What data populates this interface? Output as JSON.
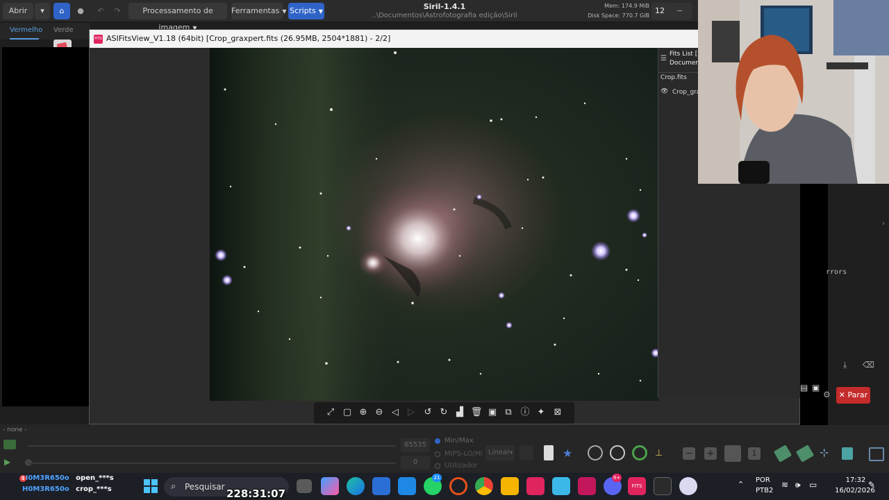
{
  "siril": {
    "title": "Siril-1.4.1",
    "path": "..\\Documentos\\Astrofotografia edição\\Siril",
    "open_label": "Abrir",
    "menu_image": "Processamento de imagem",
    "menu_tools": "Ferramentas",
    "menu_scripts": "Scripts",
    "mem": "Mem: 174.9 MiB",
    "disk": "Disk Space: 770.7 GiB",
    "threads": "12",
    "tab_red": "Vermelho",
    "tab_green": "Verde",
    "sequence_label": "- none -",
    "hi_value": "65535",
    "lo_value": "0",
    "radio_minmax": "Min/Max",
    "radio_mips": "MIPS-LO/HI",
    "radio_user": "Utilizador",
    "stretch_mode": "Linear",
    "stop_button": "Parar",
    "log_fragment": "rrors"
  },
  "fitsview": {
    "title": "ASIFitsView_V1.18 (64bit) [Crop_graxpert.fits (26.95MB, 2504*1881) - 2/2]",
    "app_icon": "FITS",
    "side_header1": "Fits List [",
    "side_header2": "Documen",
    "side_item1": "Crop.fits",
    "side_item2": "Crop_gra",
    "toolbar_icons": [
      "fit-screen-icon",
      "full-size-icon",
      "zoom-in-icon",
      "zoom-out-icon",
      "prev-icon",
      "next-icon",
      "rotate-left-icon",
      "rotate-right-icon",
      "histogram-icon",
      "delete-icon",
      "save-icon",
      "snapshot-icon",
      "info-icon",
      "star-icon",
      "crop-icon"
    ]
  },
  "taskbar": {
    "search_placeholder": "Pesquisar",
    "lang_line1": "POR",
    "lang_line2": "PTB2",
    "time": "17:32",
    "date": "16/02/2026",
    "whatsapp_badge": "21",
    "discord_badge": "9+",
    "fits_app_label": "FITS"
  },
  "stream_overlay": {
    "timer": "228:31:07",
    "chat": [
      {
        "user": "H0M3R650o",
        "message": "open_***s"
      },
      {
        "user": "H0M3R650o",
        "message": "crop_***s"
      }
    ],
    "chat_badge": "5"
  },
  "colors": {
    "accent_blue": "#2f63c7",
    "stop_red": "#c42b2b",
    "chat_user": "#4fa3ff"
  }
}
